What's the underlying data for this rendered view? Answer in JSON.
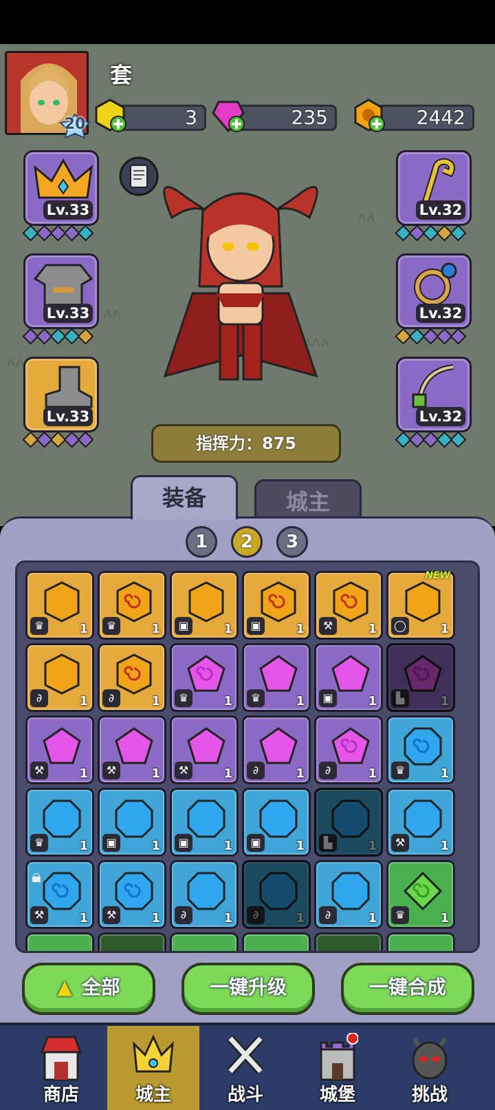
{
  "player": {
    "name": "套",
    "level": "20"
  },
  "resources": {
    "gems_yellow": "3",
    "gems_pink": "235",
    "gold": "2442"
  },
  "equipment_slots": [
    {
      "name": "crown-icon",
      "level": "Lv.33"
    },
    {
      "name": "armor-icon",
      "level": "Lv.33"
    },
    {
      "name": "boots-icon",
      "level": "Lv.33"
    },
    {
      "name": "staff-icon",
      "level": "Lv.32"
    },
    {
      "name": "ring-icon",
      "level": "Lv.32"
    },
    {
      "name": "amulet-icon",
      "level": "Lv.32"
    }
  ],
  "power_label": "指挥力：875",
  "tabs": {
    "equipment": "装备",
    "lord": "城主"
  },
  "pages": [
    "1",
    "2",
    "3"
  ],
  "inventory": {
    "new_tag": "NEW",
    "count": "1",
    "cells": [
      {
        "color": "gold",
        "swirl": false,
        "type": "crown"
      },
      {
        "color": "gold",
        "swirl": true,
        "type": "crown"
      },
      {
        "color": "gold",
        "swirl": false,
        "type": "armor"
      },
      {
        "color": "gold",
        "swirl": true,
        "type": "armor"
      },
      {
        "color": "gold",
        "swirl": true,
        "type": "staff"
      },
      {
        "color": "gold",
        "swirl": false,
        "type": "ring",
        "new": true
      },
      {
        "color": "gold",
        "swirl": false,
        "type": "amulet"
      },
      {
        "color": "gold",
        "swirl": true,
        "type": "amulet"
      },
      {
        "color": "purple",
        "swirl": true,
        "type": "crown"
      },
      {
        "color": "purple",
        "swirl": false,
        "type": "crown"
      },
      {
        "color": "purple",
        "swirl": false,
        "type": "armor"
      },
      {
        "color": "purple",
        "swirl": true,
        "type": "boots",
        "dim": true
      },
      {
        "color": "purple",
        "swirl": false,
        "type": "staff"
      },
      {
        "color": "purple",
        "swirl": false,
        "type": "staff"
      },
      {
        "color": "purple",
        "swirl": false,
        "type": "staff"
      },
      {
        "color": "purple",
        "swirl": false,
        "type": "amulet"
      },
      {
        "color": "purple",
        "swirl": true,
        "type": "amulet"
      },
      {
        "color": "blue",
        "swirl": true,
        "type": "crown"
      },
      {
        "color": "blue",
        "swirl": false,
        "type": "crown"
      },
      {
        "color": "blue",
        "swirl": false,
        "type": "armor"
      },
      {
        "color": "blue",
        "swirl": false,
        "type": "armor"
      },
      {
        "color": "blue",
        "swirl": false,
        "type": "armor"
      },
      {
        "color": "blue",
        "swirl": false,
        "type": "boots",
        "dim": true
      },
      {
        "color": "blue",
        "swirl": false,
        "type": "staff"
      },
      {
        "color": "blue",
        "swirl": true,
        "type": "staff",
        "locked": true
      },
      {
        "color": "blue",
        "swirl": true,
        "type": "staff"
      },
      {
        "color": "blue",
        "swirl": false,
        "type": "amulet"
      },
      {
        "color": "blue",
        "swirl": false,
        "type": "amulet",
        "dim": true
      },
      {
        "color": "blue",
        "swirl": false,
        "type": "amulet"
      },
      {
        "color": "green",
        "swirl": true,
        "type": "crown"
      }
    ]
  },
  "buttons": {
    "all": "全部",
    "upgrade": "一键升级",
    "merge": "一键合成"
  },
  "nav": [
    {
      "label": "商店",
      "icon": "shop-icon"
    },
    {
      "label": "城主",
      "icon": "crown-icon"
    },
    {
      "label": "战斗",
      "icon": "swords-icon"
    },
    {
      "label": "城堡",
      "icon": "castle-icon"
    },
    {
      "label": "挑战",
      "icon": "demon-icon"
    }
  ],
  "colors": {
    "gold": "#e5a93d",
    "purple": "#8a6ac5",
    "blue": "#3fa4d6",
    "green": "#4caf50"
  }
}
